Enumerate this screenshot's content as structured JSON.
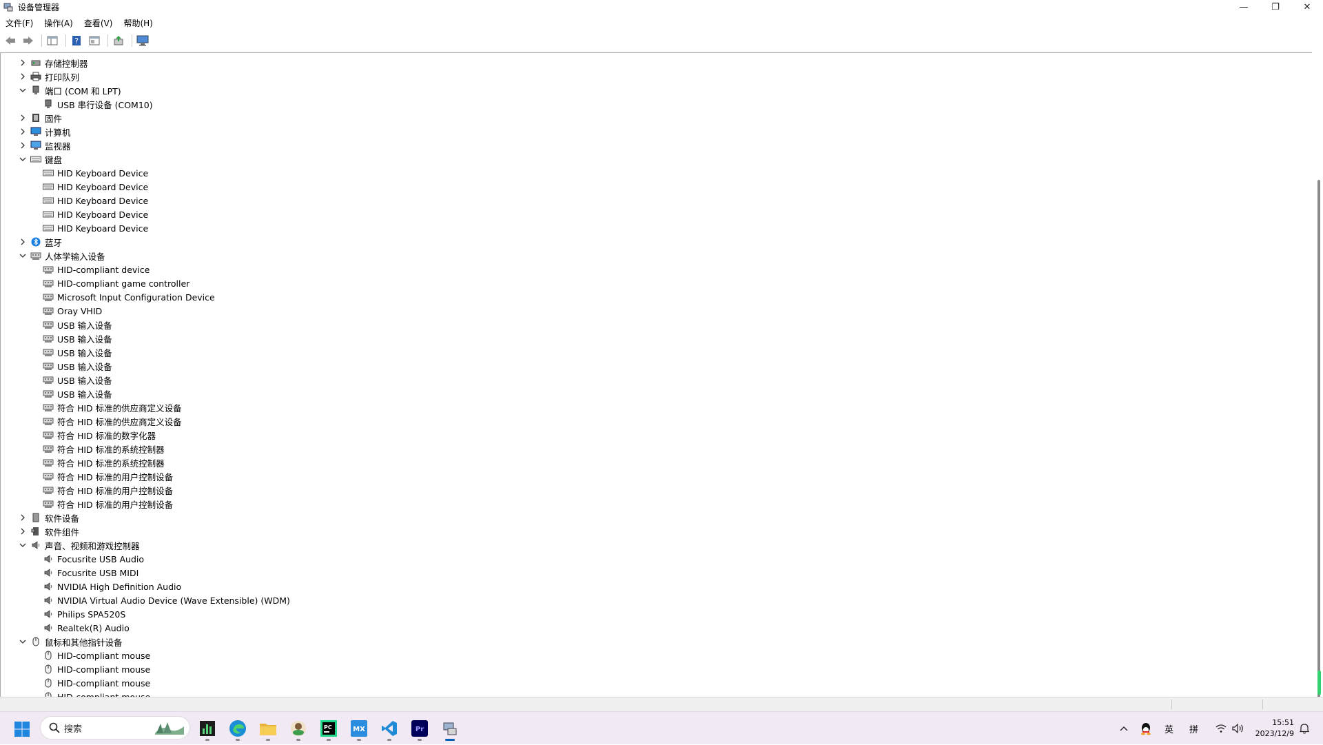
{
  "window": {
    "title": "设备管理器",
    "controls": {
      "minimize": "—",
      "maximize": "❐",
      "close": "✕"
    }
  },
  "menu": [
    "文件(F)",
    "操作(A)",
    "查看(V)",
    "帮助(H)"
  ],
  "toolbar": [
    "back-icon",
    "forward-icon",
    "properties-icon",
    "help-icon",
    "view-icon",
    "update-driver-icon",
    "monitor-icon"
  ],
  "tree": [
    {
      "level": 1,
      "expander": "collapsed",
      "icon": "storage-controller-icon",
      "label": "存储控制器"
    },
    {
      "level": 1,
      "expander": "collapsed",
      "icon": "printer-icon",
      "label": "打印队列"
    },
    {
      "level": 1,
      "expander": "expanded",
      "icon": "port-icon",
      "label": "端口 (COM 和 LPT)"
    },
    {
      "level": 2,
      "icon": "port-icon",
      "label": "USB 串行设备 (COM10)"
    },
    {
      "level": 1,
      "expander": "collapsed",
      "icon": "firmware-icon",
      "label": "固件"
    },
    {
      "level": 1,
      "expander": "collapsed",
      "icon": "computer-icon",
      "label": "计算机"
    },
    {
      "level": 1,
      "expander": "collapsed",
      "icon": "monitor-icon",
      "label": "监视器"
    },
    {
      "level": 1,
      "expander": "expanded",
      "icon": "keyboard-icon",
      "label": "键盘"
    },
    {
      "level": 2,
      "icon": "keyboard-icon",
      "label": "HID Keyboard Device"
    },
    {
      "level": 2,
      "icon": "keyboard-icon",
      "label": "HID Keyboard Device"
    },
    {
      "level": 2,
      "icon": "keyboard-icon",
      "label": "HID Keyboard Device"
    },
    {
      "level": 2,
      "icon": "keyboard-icon",
      "label": "HID Keyboard Device"
    },
    {
      "level": 2,
      "icon": "keyboard-icon",
      "label": "HID Keyboard Device"
    },
    {
      "level": 1,
      "expander": "collapsed",
      "icon": "bluetooth-icon",
      "label": "蓝牙"
    },
    {
      "level": 1,
      "expander": "expanded",
      "icon": "hid-icon",
      "label": "人体学输入设备"
    },
    {
      "level": 2,
      "icon": "hid-icon",
      "label": "HID-compliant device"
    },
    {
      "level": 2,
      "icon": "hid-icon",
      "label": "HID-compliant game controller"
    },
    {
      "level": 2,
      "icon": "hid-icon",
      "label": "Microsoft Input Configuration Device"
    },
    {
      "level": 2,
      "icon": "hid-icon",
      "label": "Oray VHID"
    },
    {
      "level": 2,
      "icon": "hid-icon",
      "label": "USB 输入设备"
    },
    {
      "level": 2,
      "icon": "hid-icon",
      "label": "USB 输入设备"
    },
    {
      "level": 2,
      "icon": "hid-icon",
      "label": "USB 输入设备"
    },
    {
      "level": 2,
      "icon": "hid-icon",
      "label": "USB 输入设备"
    },
    {
      "level": 2,
      "icon": "hid-icon",
      "label": "USB 输入设备"
    },
    {
      "level": 2,
      "icon": "hid-icon",
      "label": "USB 输入设备"
    },
    {
      "level": 2,
      "icon": "hid-icon",
      "label": "符合 HID 标准的供应商定义设备"
    },
    {
      "level": 2,
      "icon": "hid-icon",
      "label": "符合 HID 标准的供应商定义设备"
    },
    {
      "level": 2,
      "icon": "hid-icon",
      "label": "符合 HID 标准的数字化器"
    },
    {
      "level": 2,
      "icon": "hid-icon",
      "label": "符合 HID 标准的系统控制器"
    },
    {
      "level": 2,
      "icon": "hid-icon",
      "label": "符合 HID 标准的系统控制器"
    },
    {
      "level": 2,
      "icon": "hid-icon",
      "label": "符合 HID 标准的用户控制设备"
    },
    {
      "level": 2,
      "icon": "hid-icon",
      "label": "符合 HID 标准的用户控制设备"
    },
    {
      "level": 2,
      "icon": "hid-icon",
      "label": "符合 HID 标准的用户控制设备"
    },
    {
      "level": 1,
      "expander": "collapsed",
      "icon": "software-device-icon",
      "label": "软件设备"
    },
    {
      "level": 1,
      "expander": "collapsed",
      "icon": "software-component-icon",
      "label": "软件组件"
    },
    {
      "level": 1,
      "expander": "expanded",
      "icon": "speaker-icon",
      "label": "声音、视频和游戏控制器"
    },
    {
      "level": 2,
      "icon": "speaker-icon",
      "label": "Focusrite USB Audio"
    },
    {
      "level": 2,
      "icon": "speaker-icon",
      "label": "Focusrite USB MIDI"
    },
    {
      "level": 2,
      "icon": "speaker-icon",
      "label": "NVIDIA High Definition Audio"
    },
    {
      "level": 2,
      "icon": "speaker-icon",
      "label": "NVIDIA Virtual Audio Device (Wave Extensible) (WDM)"
    },
    {
      "level": 2,
      "icon": "speaker-icon",
      "label": "Philips SPA520S"
    },
    {
      "level": 2,
      "icon": "speaker-icon",
      "label": "Realtek(R) Audio"
    },
    {
      "level": 1,
      "expander": "expanded",
      "icon": "mouse-icon",
      "label": "鼠标和其他指针设备"
    },
    {
      "level": 2,
      "icon": "mouse-icon",
      "label": "HID-compliant mouse"
    },
    {
      "level": 2,
      "icon": "mouse-icon",
      "label": "HID-compliant mouse"
    },
    {
      "level": 2,
      "icon": "mouse-icon",
      "label": "HID-compliant mouse"
    },
    {
      "level": 2,
      "icon": "mouse-icon",
      "label": "HID-compliant mouse"
    }
  ],
  "taskbar": {
    "search_placeholder": "搜索",
    "apps": [
      "task-manager-icon",
      "edge-icon",
      "file-explorer-icon",
      "app-green-icon",
      "pycharm-icon",
      "mx-icon",
      "vscode-icon",
      "premiere-icon",
      "device-manager-icon"
    ],
    "tray": {
      "ime_lang": "英",
      "ime_mode": "拼",
      "time": "15:51",
      "date": "2023/12/9"
    }
  },
  "colors": {
    "accent": "#005fb8",
    "taskbar_bg": "#f1e9f3",
    "scroll_accent": "#35d16f"
  }
}
